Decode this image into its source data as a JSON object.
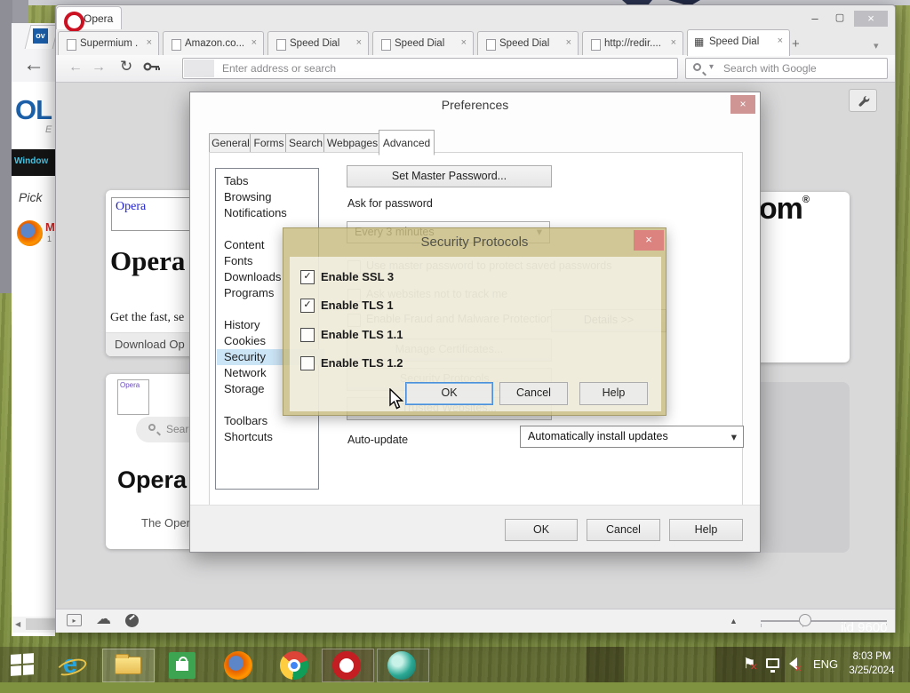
{
  "icons": {
    "close": "×",
    "check": "✓",
    "back": "←",
    "forward": "→",
    "reload": "↻",
    "up_triangle": "▲",
    "left_triangle": "◀",
    "chevron": "▾",
    "grid": "▦",
    "plus": "+",
    "win_min": "–",
    "win_max": "▢",
    "cloud": "☁",
    "flag": "⚑",
    "red_cross": "✕",
    "panel_play": "▸",
    "registered": "®"
  },
  "wallpaper": {
    "watermark_fragment": "ild 9600"
  },
  "back_window": {
    "tab_favicon": "ov",
    "logo_fragment": "OL",
    "sub_fragment": "E",
    "nav_fragment": "Window",
    "pick_fragment": "Pick",
    "firefox_fragment": "M",
    "firefox_sub": "1"
  },
  "opera": {
    "menu_label": "Opera",
    "tabs": [
      {
        "label": "Supermium ..."
      },
      {
        "label": "Amazon.co..."
      },
      {
        "label": "Speed Dial"
      },
      {
        "label": "Speed Dial"
      },
      {
        "label": "Speed Dial"
      },
      {
        "label": "http://redir...."
      },
      {
        "label": "Speed Dial"
      }
    ],
    "toolbar": {
      "address_placeholder": "Enter address or search",
      "search_placeholder": "Search with Google"
    },
    "speed_dial": {
      "card1": {
        "thumb_link": "Opera",
        "headline": "Opera",
        "body": "Get the fast, se",
        "button": "Download Op"
      },
      "card2": {
        "thumb_link": "Opera",
        "search": "Search",
        "headline": "Opera",
        "body": "The Oper"
      },
      "card3": {
        "headline": "com"
      }
    }
  },
  "preferences": {
    "title": "Preferences",
    "tabs": [
      {
        "label": "General"
      },
      {
        "label": "Forms"
      },
      {
        "label": "Search"
      },
      {
        "label": "Webpages"
      },
      {
        "label": "Advanced"
      }
    ],
    "sidebar": {
      "groups": [
        [
          "Tabs",
          "Browsing",
          "Notifications"
        ],
        [
          "Content",
          "Fonts",
          "Downloads",
          "Programs"
        ],
        [
          "History",
          "Cookies",
          "Security",
          "Network",
          "Storage"
        ],
        [
          "Toolbars",
          "Shortcuts"
        ]
      ],
      "selected": "Security"
    },
    "panel": {
      "set_master_password": "Set Master Password...",
      "ask_for_password": "Ask for password",
      "interval_value": "Every 3 minutes",
      "use_master_label": "Use master password to protect saved passwords",
      "track_label": "Ask websites not to track me",
      "fraud_label": "Enable Fraud and Malware Protection",
      "details_button": "Details >>",
      "manage_certificates": "Manage Certificates...",
      "security_protocols": "Security Protocols...",
      "trusted_websites": "Trusted Websites...",
      "auto_update_label": "Auto-update",
      "auto_update_value": "Automatically install updates"
    },
    "footer": {
      "ok": "OK",
      "cancel": "Cancel",
      "help": "Help"
    }
  },
  "security_dialog": {
    "title": "Security Protocols",
    "checkboxes": [
      {
        "label": "Enable SSL 3",
        "checked": true,
        "mark": "✓"
      },
      {
        "label": "Enable TLS 1",
        "checked": true,
        "mark": "✓"
      },
      {
        "label": "Enable TLS 1.1",
        "checked": false,
        "mark": ""
      },
      {
        "label": "Enable TLS 1.2",
        "checked": false,
        "mark": ""
      }
    ],
    "buttons": {
      "ok": "OK",
      "cancel": "Cancel",
      "help": "Help"
    }
  },
  "taskbar": {
    "tray": {
      "language": "ENG",
      "time": "8:03 PM",
      "date": "3/25/2024"
    }
  }
}
